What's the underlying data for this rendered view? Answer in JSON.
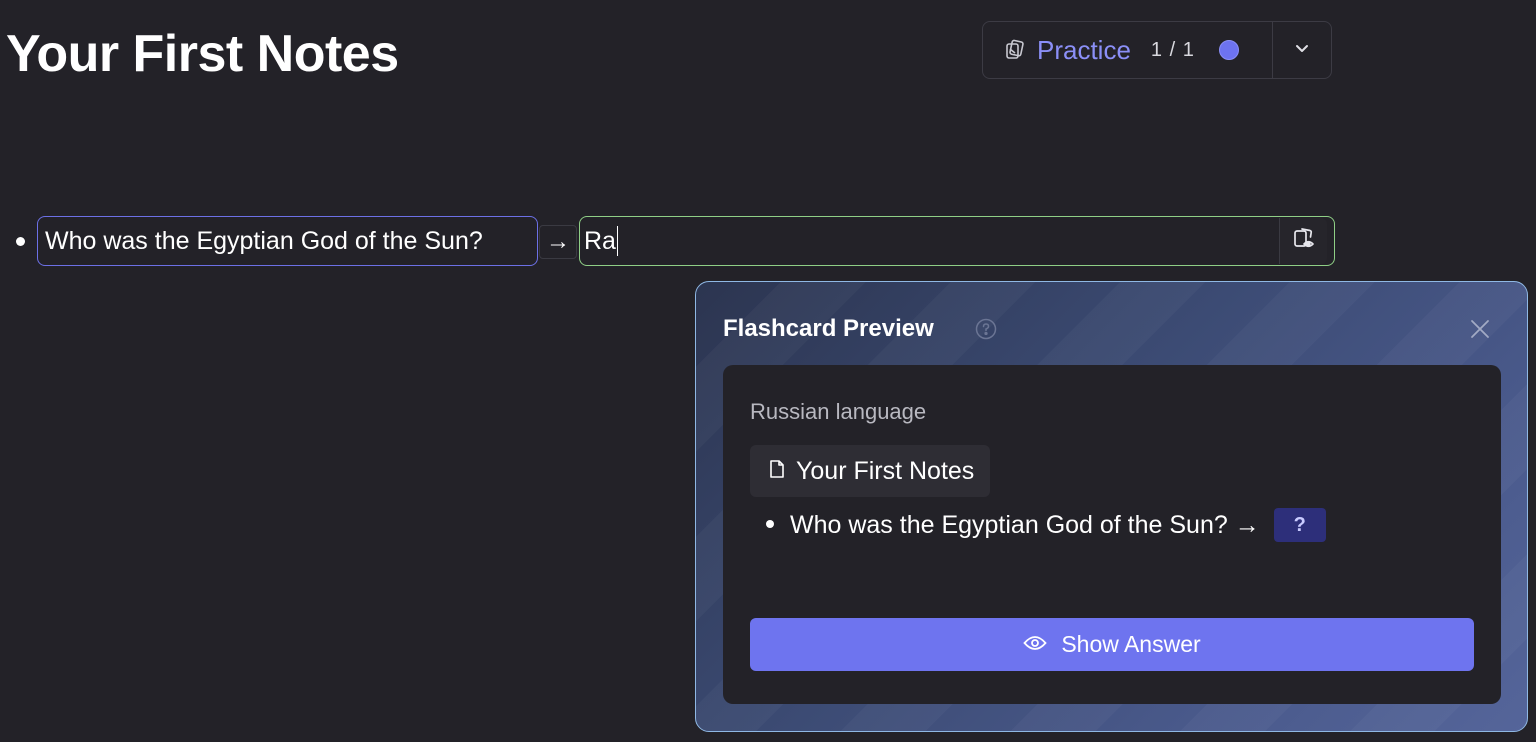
{
  "page": {
    "title": "Your First Notes"
  },
  "practice": {
    "label": "Practice",
    "count": "1 / 1",
    "icons": {
      "cards": "cards-stack-icon",
      "dropdown": "chevron-down-icon"
    },
    "accent": "#8b8ff7"
  },
  "note": {
    "question": "Who was the Egyptian God of the Sun?",
    "separator": "→",
    "answer": "Ra",
    "preview_icon": "card-preview-icon"
  },
  "flashcard_preview": {
    "title": "Flashcard Preview",
    "help_icon": "help-circle-icon",
    "close_icon": "close-icon",
    "card": {
      "category": "Russian language",
      "document": "Your First Notes",
      "document_icon": "document-icon",
      "question": "Who was the Egyptian God of the Sun? →",
      "cloze": "?",
      "show_answer_label": "Show Answer",
      "show_answer_icon": "eye-icon"
    }
  },
  "colors": {
    "background": "#232228",
    "question_border": "#6c70e6",
    "answer_border": "#8fcf86",
    "button": "#6e74ef"
  }
}
